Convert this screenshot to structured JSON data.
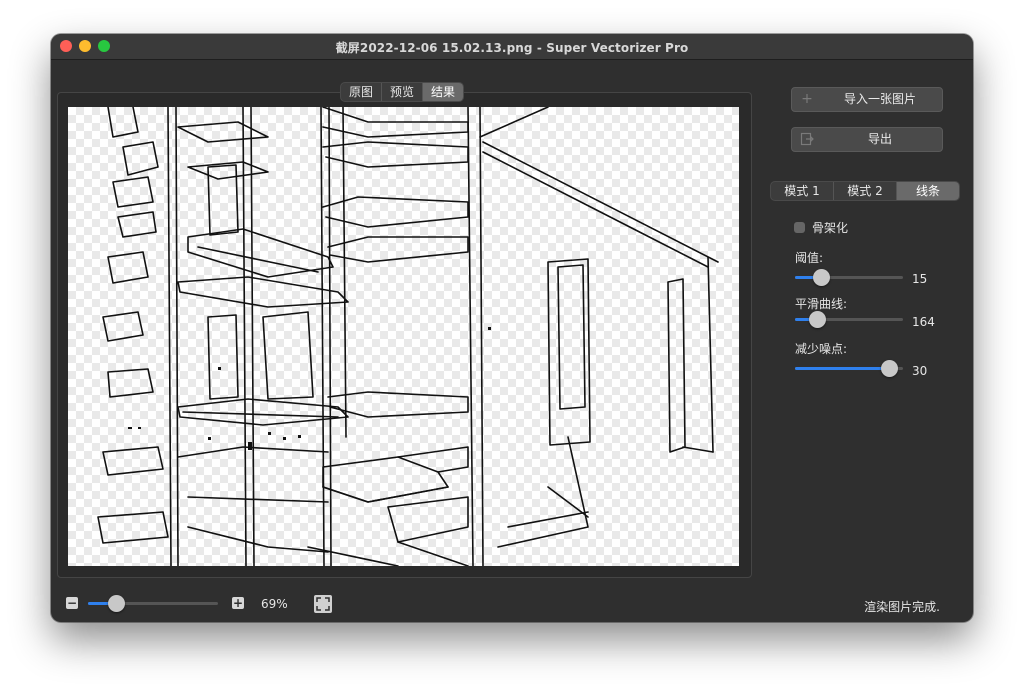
{
  "window": {
    "title": "截屏2022-12-06 15.02.13.png - Super Vectorizer Pro"
  },
  "view_tabs": [
    {
      "label": "原图",
      "active": false
    },
    {
      "label": "预览",
      "active": false
    },
    {
      "label": "结果",
      "active": true
    }
  ],
  "sidebar": {
    "import_button": {
      "label": "导入一张图片",
      "icon": "plus-icon"
    },
    "export_button": {
      "label": "导出",
      "icon": "export-icon"
    },
    "mode_tabs": [
      {
        "label": "模式 1",
        "active": false
      },
      {
        "label": "模式 2",
        "active": false
      },
      {
        "label": "线条",
        "active": true
      }
    ],
    "skeletonize": {
      "label": "骨架化",
      "checked": false
    },
    "threshold": {
      "label": "阈值:",
      "value": "15",
      "fraction": 0.2
    },
    "smooth_curve": {
      "label": "平滑曲线:",
      "value": "164",
      "fraction": 0.15
    },
    "noise_reduction": {
      "label": "减少噪点:",
      "value": "30",
      "fraction": 0.95
    }
  },
  "bottom_bar": {
    "zoom_out_icon": "minus-icon",
    "zoom_in_icon": "plus-icon",
    "zoom_value": "69%",
    "zoom_fraction": 0.18,
    "fit_icon": "fit-to-window-icon",
    "status": "渲染图片完成."
  },
  "colors": {
    "accent": "#2f80ed",
    "window_bg": "#2f2f2f"
  }
}
